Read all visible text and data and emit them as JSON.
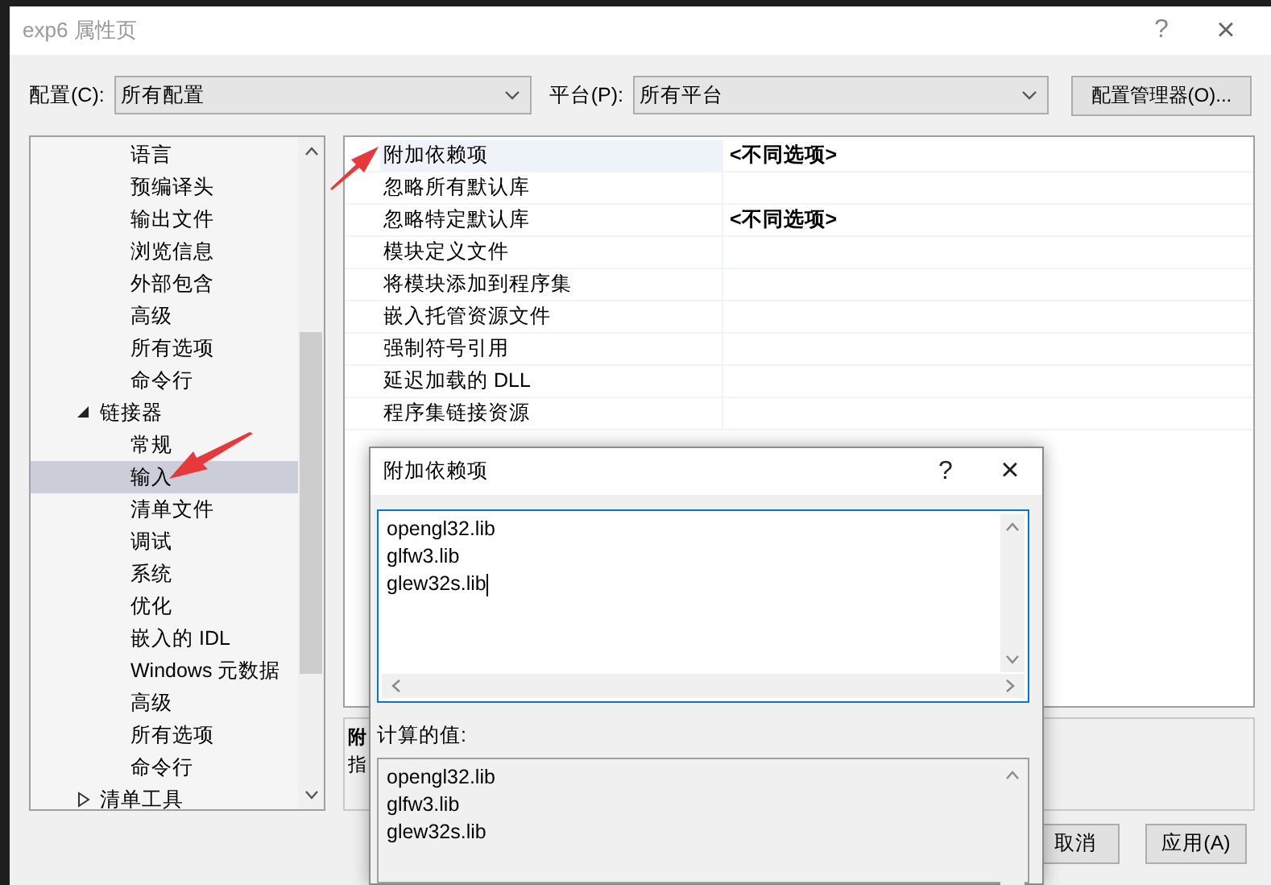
{
  "window": {
    "title": "exp6 属性页",
    "help": "?",
    "close": "×"
  },
  "config": {
    "label": "配置(C):",
    "value": "所有配置"
  },
  "platform": {
    "label": "平台(P):",
    "value": "所有平台"
  },
  "config_manager_button": "配置管理器(O)...",
  "tree": {
    "scrolled_children": [
      {
        "label": "语言",
        "selected": false
      },
      {
        "label": "预编译头",
        "selected": false
      },
      {
        "label": "输出文件",
        "selected": false
      },
      {
        "label": "浏览信息",
        "selected": false
      },
      {
        "label": "外部包含",
        "selected": false
      },
      {
        "label": "高级",
        "selected": false
      },
      {
        "label": "所有选项",
        "selected": false
      },
      {
        "label": "命令行",
        "selected": false
      }
    ],
    "items": [
      {
        "label": "链接器",
        "expanded": true,
        "selected": false,
        "children": [
          {
            "label": "常规",
            "selected": false
          },
          {
            "label": "输入",
            "selected": true
          },
          {
            "label": "清单文件",
            "selected": false
          },
          {
            "label": "调试",
            "selected": false
          },
          {
            "label": "系统",
            "selected": false
          },
          {
            "label": "优化",
            "selected": false
          },
          {
            "label": "嵌入的 IDL",
            "selected": false
          },
          {
            "label": "Windows 元数据",
            "selected": false
          },
          {
            "label": "高级",
            "selected": false
          },
          {
            "label": "所有选项",
            "selected": false
          },
          {
            "label": "命令行",
            "selected": false
          }
        ]
      },
      {
        "label": "清单工具",
        "expanded": false,
        "selected": false
      }
    ]
  },
  "properties": [
    {
      "name": "附加依赖项",
      "value": "<不同选项>",
      "selected": true
    },
    {
      "name": "忽略所有默认库",
      "selected": false
    },
    {
      "name": "忽略特定默认库",
      "value": "<不同选项>",
      "selected": false
    },
    {
      "name": "模块定义文件",
      "selected": false
    },
    {
      "name": "将模块添加到程序集",
      "selected": false
    },
    {
      "name": "嵌入托管资源文件",
      "selected": false
    },
    {
      "name": "强制符号引用",
      "selected": false
    },
    {
      "name": "延迟加载的 DLL",
      "selected": false
    },
    {
      "name": "程序集链接资源",
      "selected": false
    }
  ],
  "description": {
    "title": "附",
    "text": "指"
  },
  "buttons": [
    "取消",
    "应用(A)"
  ],
  "popup": {
    "title": "附加依赖项",
    "help": "?",
    "close": "×",
    "value": [
      "opengl32.lib",
      "glfw3.lib",
      "glew32s.lib"
    ],
    "computed_label": "计算的值:",
    "computed": [
      "opengl32.lib",
      "glfw3.lib",
      "glew32s.lib"
    ]
  }
}
